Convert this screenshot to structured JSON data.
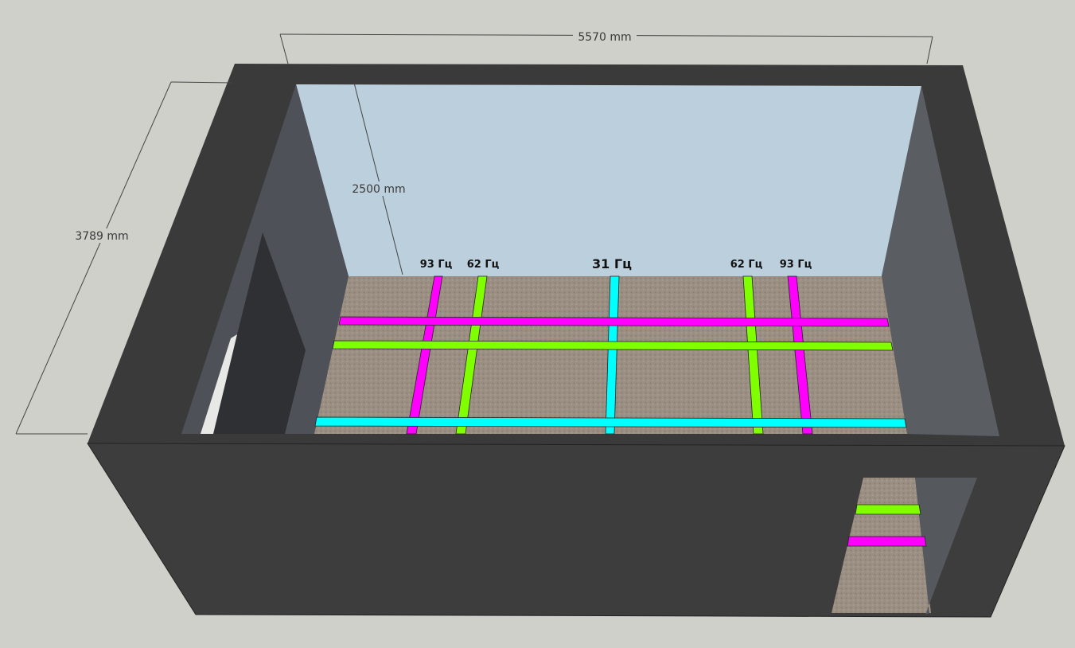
{
  "dimensions": {
    "width_label": "5570 mm",
    "depth_label": "3789 mm",
    "height_label": "2500 mm"
  },
  "frequency_labels": {
    "left_93": "93 Гц",
    "left_62": "62 Гц",
    "center_31": "31 Гц",
    "right_62": "62 Гц",
    "right_93": "93 Гц"
  },
  "colors": {
    "hz_93": "#ff00ff",
    "hz_62": "#80ff00",
    "hz_31": "#00ffff",
    "wall": "#4a4a4a",
    "back_wall": "#bccfdc",
    "floor": "#9a8d80"
  }
}
